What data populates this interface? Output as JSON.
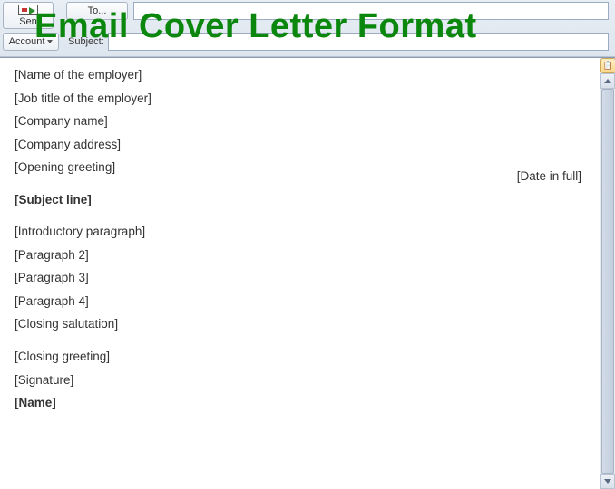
{
  "overlay": {
    "title": "Email Cover Letter Format"
  },
  "header": {
    "send_label": "Sen",
    "to_label": "To...",
    "account_label": "Account",
    "subject_label": "Subject:"
  },
  "body": {
    "lines": [
      {
        "text": "[Name of the employer]",
        "bold": false
      },
      {
        "text": "[Job title of the employer]",
        "bold": false
      },
      {
        "text": "[Company name]",
        "bold": false
      },
      {
        "text": "[Company address]",
        "bold": false
      },
      {
        "text": "[Opening greeting]",
        "bold": false
      }
    ],
    "date": "[Date in full]",
    "subject_line": "[Subject line]",
    "paragraphs": [
      "[Introductory paragraph]",
      "[Paragraph 2]",
      "[Paragraph 3]",
      "[Paragraph 4]",
      "[Closing salutation]"
    ],
    "closing": [
      {
        "text": "[Closing greeting]",
        "bold": false
      },
      {
        "text": "[Signature]",
        "bold": false
      },
      {
        "text": "[Name]",
        "bold": true
      }
    ]
  }
}
